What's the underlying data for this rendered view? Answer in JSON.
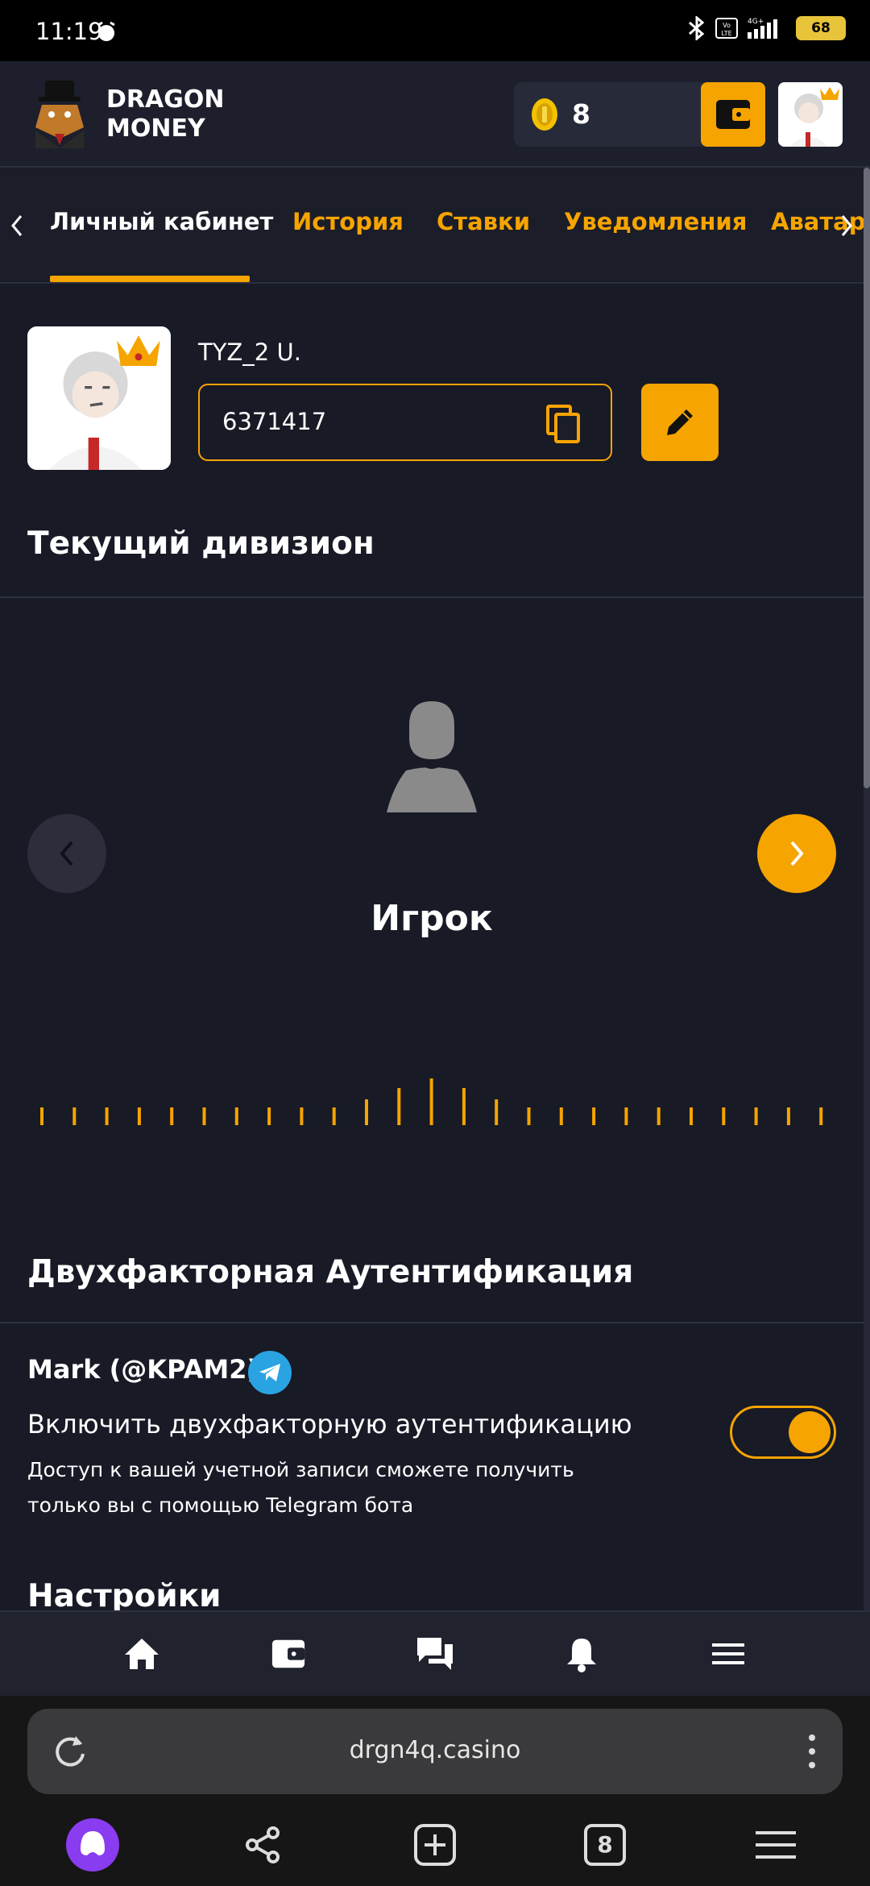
{
  "status_bar": {
    "time": "11:19",
    "battery": "68",
    "network": "4G+"
  },
  "header": {
    "brand_line1": "DRAGON",
    "brand_line2": "MONEY",
    "balance": "8"
  },
  "tabs": [
    {
      "label": "Личный кабинет",
      "active": true
    },
    {
      "label": "История",
      "active": false
    },
    {
      "label": "Ставки",
      "active": false
    },
    {
      "label": "Уведомления",
      "active": false
    },
    {
      "label": "Аватар",
      "active": false
    }
  ],
  "profile": {
    "username": "TYZ_2 U.",
    "user_id": "6371417"
  },
  "division": {
    "section_title": "Текущий дивизион",
    "name": "Игрок"
  },
  "two_factor": {
    "section_title": "Двухфакторная Аутентификация",
    "telegram_account": "Mark (@KPAM2)",
    "toggle_label": "Включить двухфакторную аутентификацию",
    "description": "Доступ к вашей учетной записи сможете получить только вы с помощью Telegram бота",
    "enabled": true
  },
  "settings": {
    "section_title": "Настройки"
  },
  "site_nav": [
    "home-icon",
    "wallet-icon",
    "chat-icon",
    "bell-icon",
    "menu-icon"
  ],
  "browser": {
    "url": "drgn4q.casino",
    "tab_count": "8"
  },
  "colors": {
    "accent": "#f6a400",
    "background": "#181a26",
    "header": "#1d1f2c",
    "telegram": "#2aa3e2"
  }
}
